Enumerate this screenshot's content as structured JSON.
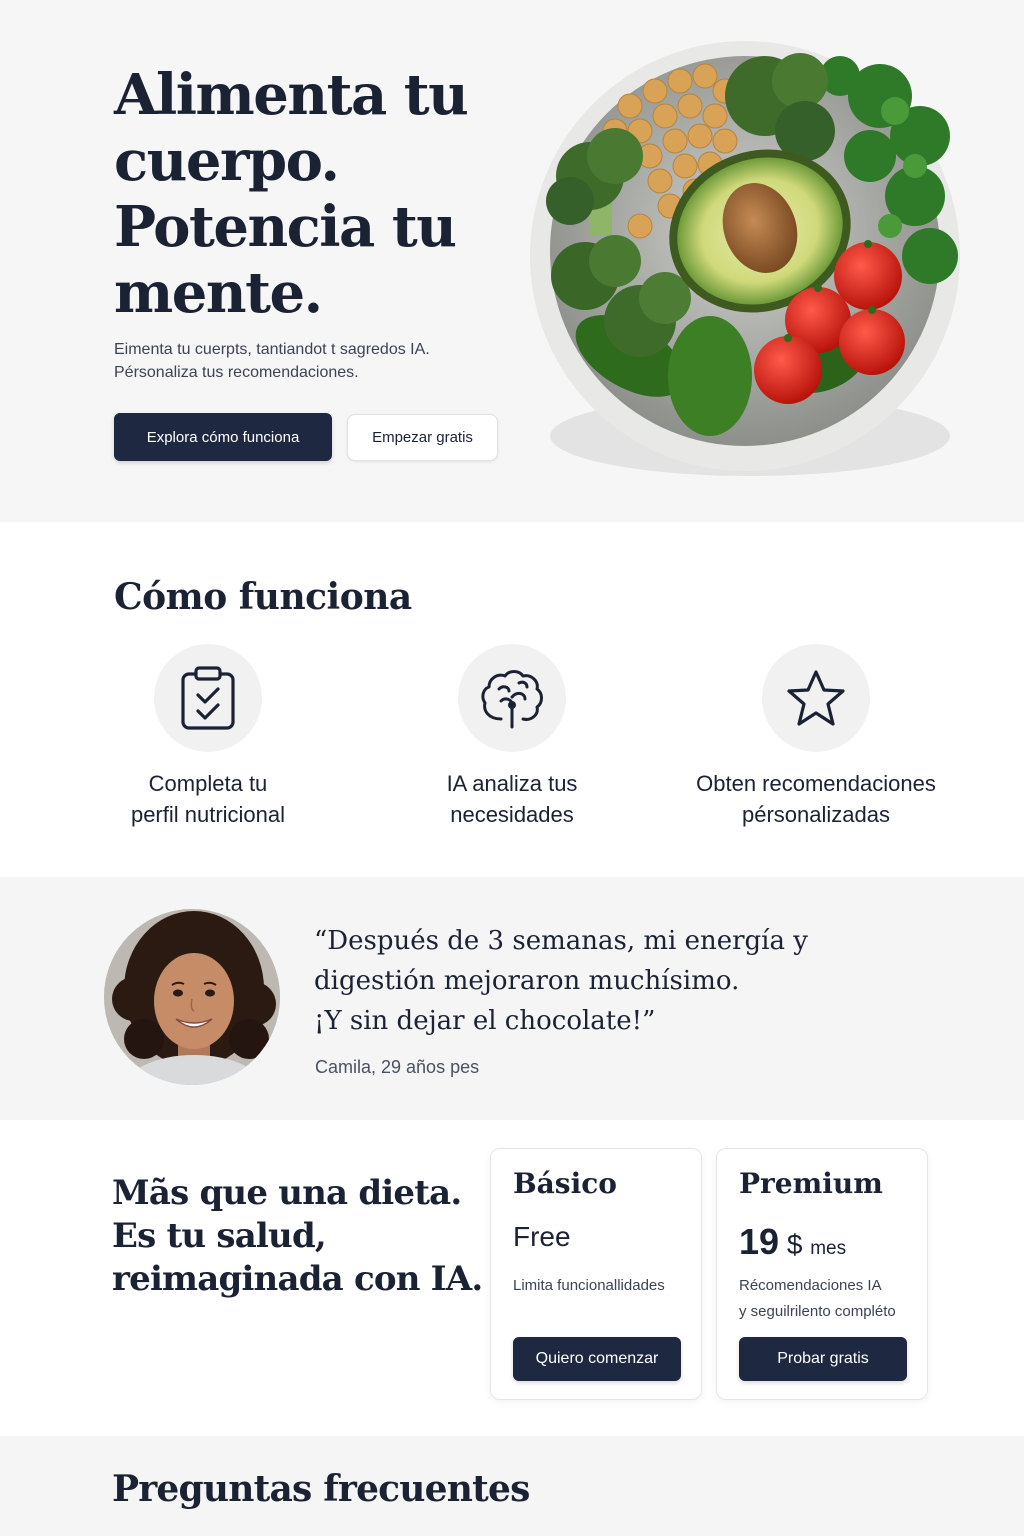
{
  "hero": {
    "title": "Alimenta tu cuerpo. Potencia tu mente.",
    "subtitle": "Eimenta tu cuerpts, tantiandot t sagredos IA. Pérsonaliza tus recomendaciones.",
    "primary_button": "Explora cómo funciona",
    "secondary_button": "Empezar gratis",
    "image": "salad-bowl-image"
  },
  "how": {
    "title": "Cómo funciona",
    "steps": [
      {
        "icon": "clipboard-check-icon",
        "label": "Completa tu\nperfil nutricional"
      },
      {
        "icon": "brain-icon",
        "label": "IA analiza tus\nnecesidades"
      },
      {
        "icon": "star-icon",
        "label": "Obten recomendaciones\npérsonalizadas"
      }
    ]
  },
  "testimonial": {
    "quote": "“Después de 3 semanas, mi energía y\ndigestión mejoraron muchísimo.\n¡Y sin dejar el chocolate!”",
    "author": "Camila, 29 años pes",
    "avatar": "customer-avatar"
  },
  "pricing": {
    "title": "Mãs que una dieta.\nEs tu salud,\nreimaginada con IA.",
    "plans": [
      {
        "name": "Básico",
        "price": "Free",
        "description": "Limita funcionallidades",
        "button": "Quiero comenzar"
      },
      {
        "name": "Premium",
        "price_amount": "19",
        "price_currency": "$",
        "price_period": "mes",
        "description": "Récomendaciones IA\ny seguilrilento compléto",
        "button": "Probar gratis"
      }
    ]
  },
  "faq": {
    "title": "Preguntas frecuentes"
  },
  "colors": {
    "primary": "#1e2840",
    "text": "#1b2233",
    "background_alt": "#f5f5f5"
  }
}
